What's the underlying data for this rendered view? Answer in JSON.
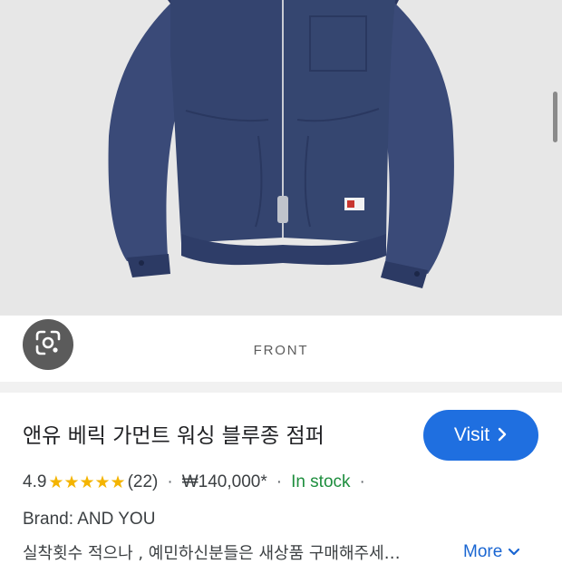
{
  "product_image": {
    "caption": "FRONT"
  },
  "product": {
    "title": "앤유 베릭 가먼트 워싱 블루종 점퍼",
    "visit_label": "Visit",
    "rating": "4.9",
    "stars_text": "★★★★★",
    "review_count": "(22)",
    "price": "₩140,000*",
    "availability": "In stock",
    "brand": "Brand: AND YOU",
    "description": "실착횟수 적으나 , 예민하신분들은 새상품 구매해주세…",
    "more_label": "More"
  },
  "colors": {
    "accent": "#1f6fe0",
    "star": "#f4b400",
    "in_stock": "#1e8e3e",
    "link": "#1a66d2"
  }
}
